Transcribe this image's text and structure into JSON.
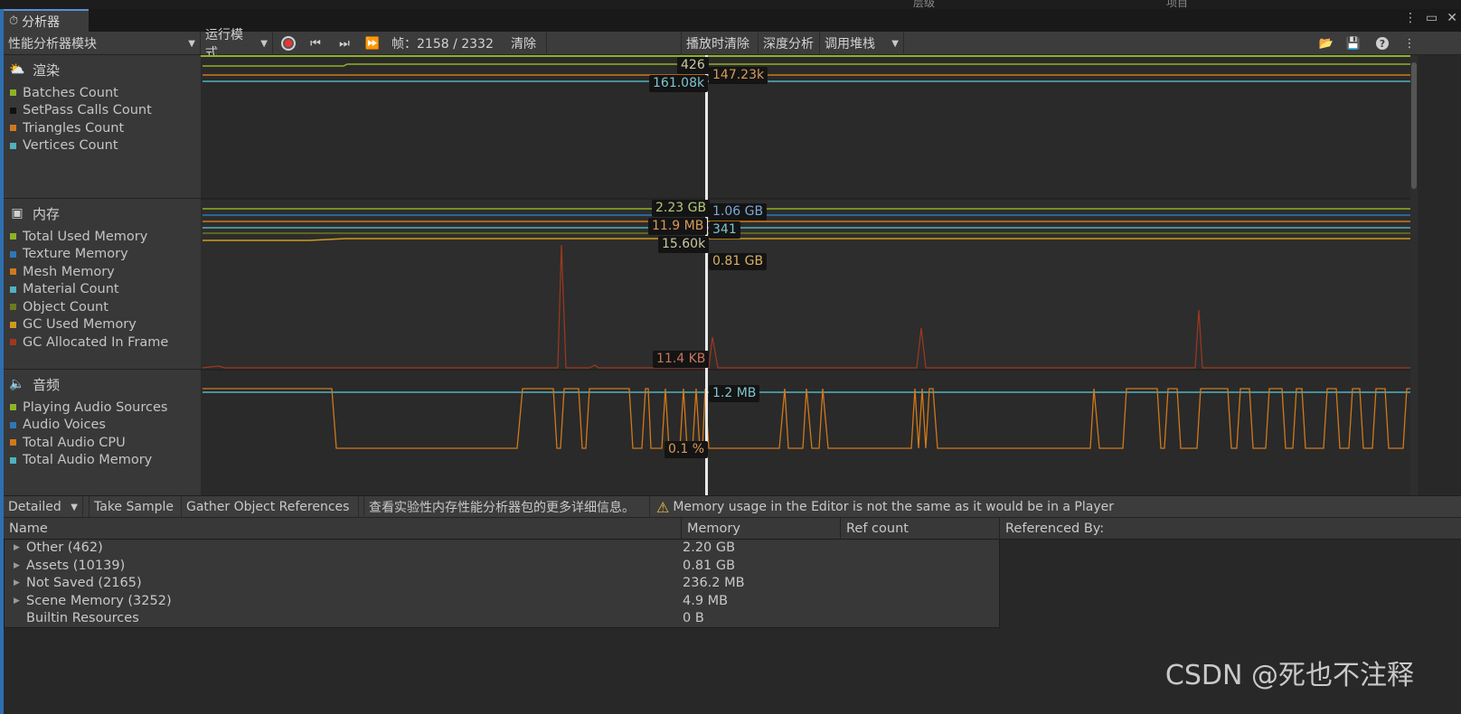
{
  "window": {
    "tab_title": "分析器",
    "top_strip_left": "层级",
    "top_strip_right": "项目"
  },
  "toolbar": {
    "modules_dropdown": "性能分析器模块",
    "mode_dropdown": "运行模式",
    "frame_label": "帧：2158 / 2332",
    "clear_label": "清除",
    "clear_on_play_label": "播放时清除",
    "deep_profile_label": "深度分析",
    "call_stacks_label": "调用堆栈"
  },
  "modules": {
    "rendering": {
      "title": "渲染",
      "legend": [
        {
          "label": "Batches Count",
          "color": "#8fb225"
        },
        {
          "label": "SetPass Calls Count",
          "color": "#111111"
        },
        {
          "label": "Triangles Count",
          "color": "#d0791a"
        },
        {
          "label": "Vertices Count",
          "color": "#4eb2c0"
        }
      ]
    },
    "memory": {
      "title": "内存",
      "legend": [
        {
          "label": "Total Used Memory",
          "color": "#8fb225"
        },
        {
          "label": "Texture Memory",
          "color": "#2c79b8"
        },
        {
          "label": "Mesh Memory",
          "color": "#d0791a"
        },
        {
          "label": "Material Count",
          "color": "#4eb2c0"
        },
        {
          "label": "Object Count",
          "color": "#6e7a1a"
        },
        {
          "label": "GC Used Memory",
          "color": "#d09a1a"
        },
        {
          "label": "GC Allocated In Frame",
          "color": "#a0381e"
        }
      ]
    },
    "audio": {
      "title": "音频",
      "legend": [
        {
          "label": "Playing Audio Sources",
          "color": "#8fb225"
        },
        {
          "label": "Audio Voices",
          "color": "#2c79b8"
        },
        {
          "label": "Total Audio CPU",
          "color": "#d0791a"
        },
        {
          "label": "Total Audio Memory",
          "color": "#4eb2c0"
        }
      ]
    }
  },
  "value_labels": {
    "rendering_batches": "426",
    "rendering_vertices": "161.08k",
    "rendering_triangles": "147.23k",
    "memory_total": "2.23 GB",
    "memory_texture": "1.06 GB",
    "memory_mesh": "11.9 MB",
    "memory_material": "341",
    "memory_object": "15.60k",
    "memory_gc_used": "0.81 GB",
    "memory_gc_alloc": "11.4 KB",
    "audio_memory": "1.2 MB",
    "audio_cpu": "0.1 %"
  },
  "details_toolbar": {
    "view_dropdown": "Detailed",
    "take_sample": "Take Sample",
    "gather_refs": "Gather Object References",
    "info_link": "查看实验性内存性能分析器包的更多详细信息。",
    "warning": "Memory usage in the Editor is not the same as it would be in a Player"
  },
  "table": {
    "columns": [
      "Name",
      "Memory",
      "Ref count",
      "Referenced By:"
    ],
    "rows": [
      {
        "name": "Other (462)",
        "memory": "2.20 GB",
        "expandable": true
      },
      {
        "name": "Assets (10139)",
        "memory": "0.81 GB",
        "expandable": true
      },
      {
        "name": "Not Saved (2165)",
        "memory": "236.2 MB",
        "expandable": true
      },
      {
        "name": "Scene Memory (3252)",
        "memory": "4.9 MB",
        "expandable": true
      },
      {
        "name": "Builtin Resources",
        "memory": "0 B",
        "expandable": false
      }
    ]
  },
  "watermark": "CSDN @死也不注释"
}
